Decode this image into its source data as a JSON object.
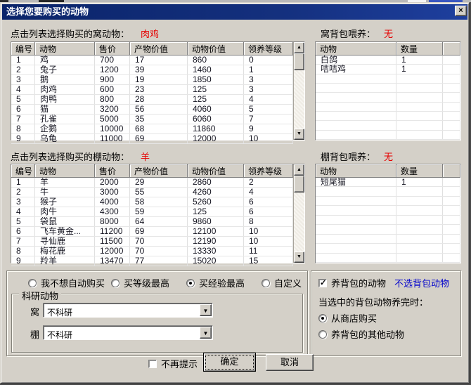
{
  "win": {
    "title": "选择您要购买的动物"
  },
  "icons": {
    "close": "×",
    "up": "▲",
    "down": "▼",
    "combo": "▼",
    "check": "✓"
  },
  "coop": {
    "label": "点击列表选择购买的窝动物：",
    "value": "肉鸡",
    "headers": [
      "编号",
      "动物",
      "售价",
      "产物价值",
      "动物价值",
      "领养等级"
    ],
    "rows": [
      [
        "1",
        "鸡",
        "700",
        "17",
        "860",
        "0"
      ],
      [
        "2",
        "兔子",
        "1200",
        "39",
        "1460",
        "1"
      ],
      [
        "3",
        "鹅",
        "900",
        "19",
        "1850",
        "3"
      ],
      [
        "4",
        "肉鸡",
        "600",
        "23",
        "125",
        "3"
      ],
      [
        "5",
        "肉鸭",
        "800",
        "28",
        "125",
        "4"
      ],
      [
        "6",
        "猫",
        "3200",
        "56",
        "4060",
        "5"
      ],
      [
        "7",
        "孔雀",
        "5000",
        "35",
        "6060",
        "7"
      ],
      [
        "8",
        "企鹅",
        "10000",
        "68",
        "11860",
        "9"
      ],
      [
        "9",
        "乌龟",
        "11000",
        "69",
        "12000",
        "10"
      ]
    ]
  },
  "coopBag": {
    "label": "窝背包喂养：",
    "value": "无",
    "headers": [
      "动物",
      "数量"
    ],
    "rows": [
      [
        "白鸽",
        "1"
      ],
      [
        "咭咭鸡",
        "1"
      ]
    ]
  },
  "shed": {
    "label": "点击列表选择购买的棚动物：",
    "value": "羊",
    "headers": [
      "编号",
      "动物",
      "售价",
      "产物价值",
      "动物价值",
      "领养等级"
    ],
    "rows": [
      [
        "1",
        "羊",
        "2000",
        "29",
        "2860",
        "2"
      ],
      [
        "2",
        "牛",
        "3000",
        "55",
        "4260",
        "4"
      ],
      [
        "3",
        "猴子",
        "4000",
        "58",
        "5260",
        "6"
      ],
      [
        "4",
        "肉牛",
        "4300",
        "59",
        "125",
        "6"
      ],
      [
        "5",
        "袋鼠",
        "8000",
        "64",
        "9860",
        "8"
      ],
      [
        "6",
        "飞车黄金...",
        "11200",
        "69",
        "12100",
        "10"
      ],
      [
        "7",
        "寻仙鹿",
        "11500",
        "70",
        "12190",
        "10"
      ],
      [
        "8",
        "梅花鹿",
        "12000",
        "70",
        "13330",
        "11"
      ],
      [
        "9",
        "羚羊",
        "13470",
        "77",
        "15020",
        "15"
      ]
    ]
  },
  "shedBag": {
    "label": "棚背包喂养：",
    "value": "无",
    "headers": [
      "动物",
      "数量"
    ],
    "rows": [
      [
        "短尾猫",
        "1"
      ]
    ]
  },
  "mode": {
    "options": [
      {
        "label": "我不想自动购买",
        "selected": false
      },
      {
        "label": "买等级最高",
        "selected": false
      },
      {
        "label": "买经验最高",
        "selected": true
      },
      {
        "label": "自定义",
        "selected": false
      }
    ]
  },
  "research": {
    "title": "科研动物",
    "rows": [
      {
        "label": "窝",
        "value": "不科研"
      },
      {
        "label": "棚",
        "value": "不科研"
      }
    ]
  },
  "bagOpts": {
    "feedLabel": "养背包的动物",
    "feedChecked": true,
    "link": "不选背包动物",
    "question": "当选中的背包动物养完时：",
    "options": [
      {
        "label": "从商店购买",
        "selected": true
      },
      {
        "label": "养背包的其他动物",
        "selected": false
      }
    ]
  },
  "footer": {
    "noPrompt": "不再提示",
    "ok": "确定",
    "cancel": "取消"
  },
  "colors": {
    "titlebar": "#0a246a",
    "red": "#e60000",
    "link": "#0000cc",
    "face": "#d4d0c8"
  }
}
